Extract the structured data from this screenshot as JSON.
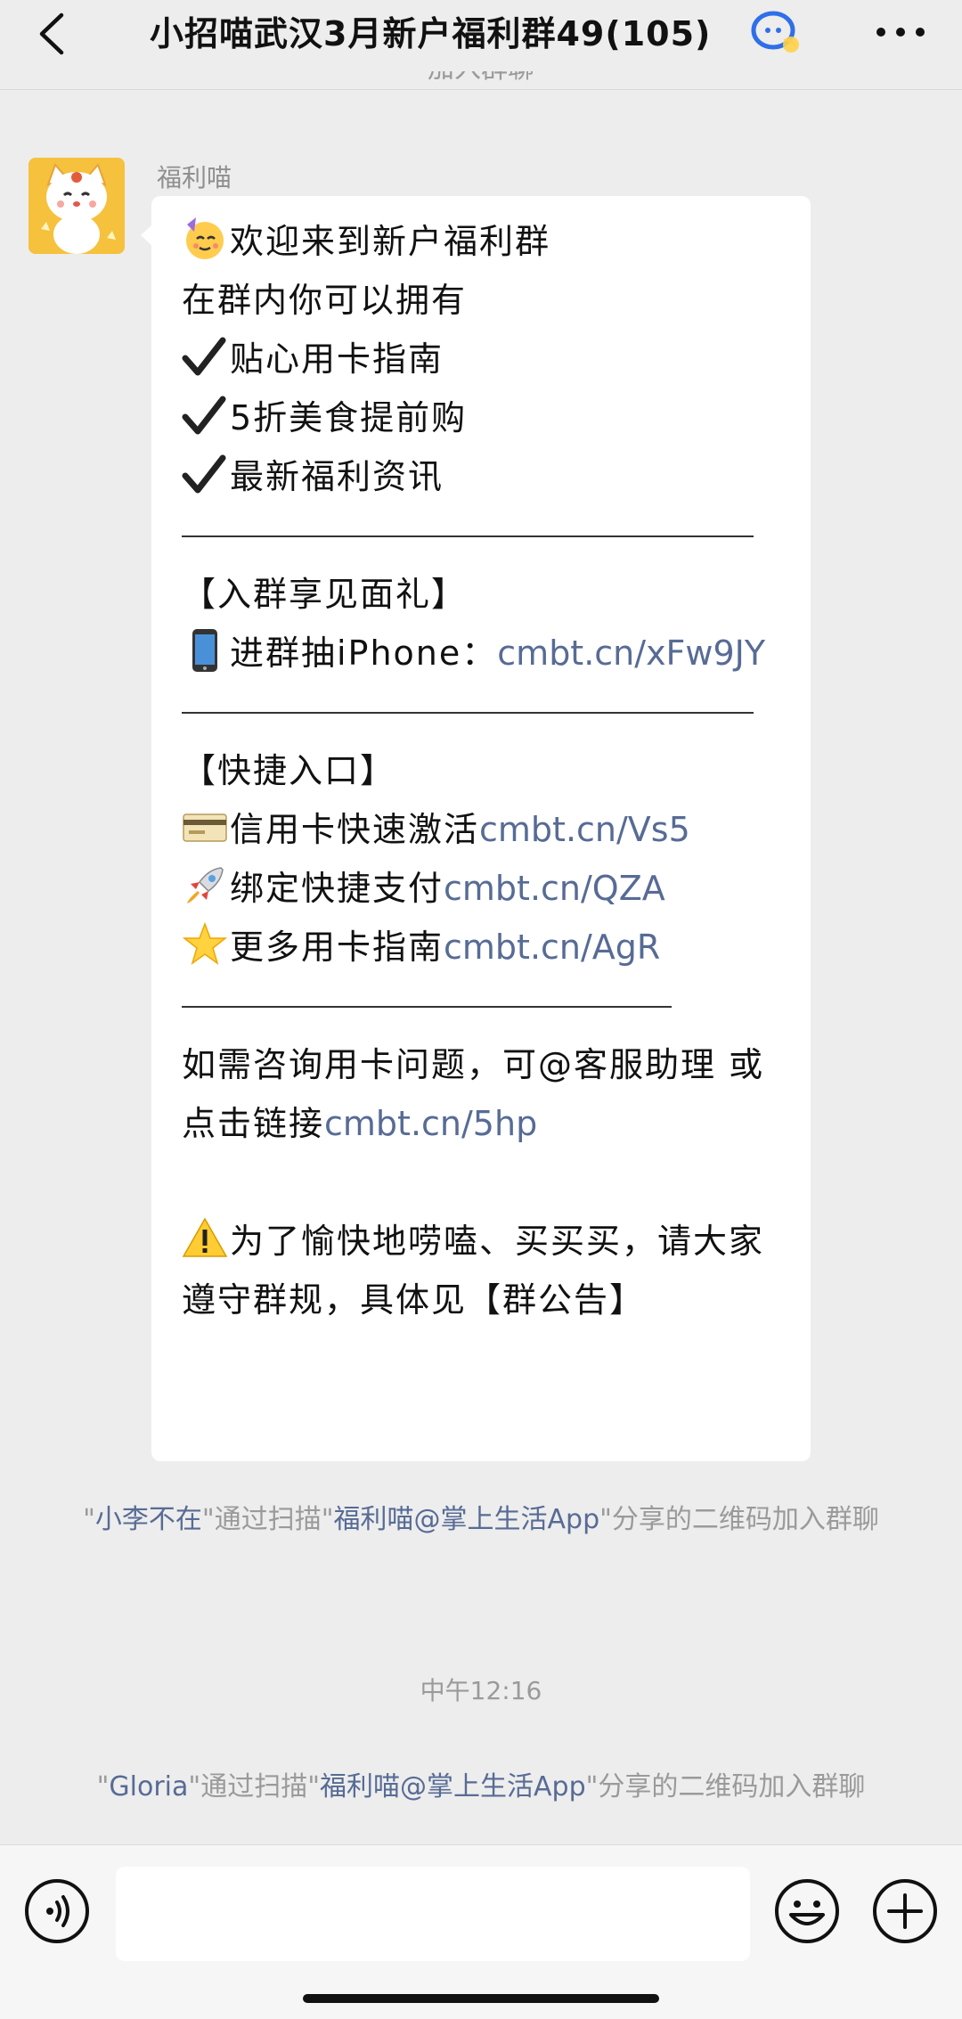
{
  "header": {
    "title": "小招喵武汉3月新户福利群49(105)"
  },
  "icons": {
    "back": "chevron-left-icon",
    "group": "group-chat-icon",
    "more": "more-dots-icon",
    "voice": "voice-icon",
    "emoji": "emoji-face-icon",
    "plus": "plus-icon"
  },
  "chat": {
    "top_system_cut": "加入群聊",
    "sender": "福利喵",
    "message": {
      "l1": "欢迎来到新户福利群",
      "l2": "在群内你可以拥有",
      "l3": "贴心用卡指南",
      "l4": "5折美食提前购",
      "l5": "最新福利资讯",
      "l6": "【入群享见面礼】",
      "l7_text": "进群抽iPhone：",
      "l7_link": "cmbt.cn/xFw9JY",
      "l8": "【快捷入口】",
      "l9_text": "信用卡快速激活",
      "l9_link": "cmbt.cn/Vs5",
      "l10_text": "绑定快捷支付",
      "l10_link": "cmbt.cn/QZA",
      "l11_text": "更多用卡指南",
      "l11_link": "cmbt.cn/AgR",
      "l12_text": "如需咨询用卡问题，可@客服助理 或点击链接",
      "l12_link": "cmbt.cn/5hp",
      "l13": "为了愉快地唠嗑、买买买，请大家遵守群规，具体见【群公告】"
    },
    "system1": {
      "q1": "\"",
      "name": "小李不在",
      "mid": "\"通过扫描\"",
      "app": "福利喵@掌上生活App",
      "tail": "\"分享的二维码加入群聊"
    },
    "time": "中午12:16",
    "system2": {
      "q1": "\"",
      "name": "Gloria",
      "mid": "\"通过扫描\"",
      "app": "福利喵@掌上生活App",
      "tail": "\"分享的二维码加入群聊"
    }
  },
  "input": {
    "value": "",
    "placeholder": ""
  },
  "colors": {
    "background": "#ededed",
    "link": "#576b95",
    "system_text": "#9a9a9a"
  }
}
